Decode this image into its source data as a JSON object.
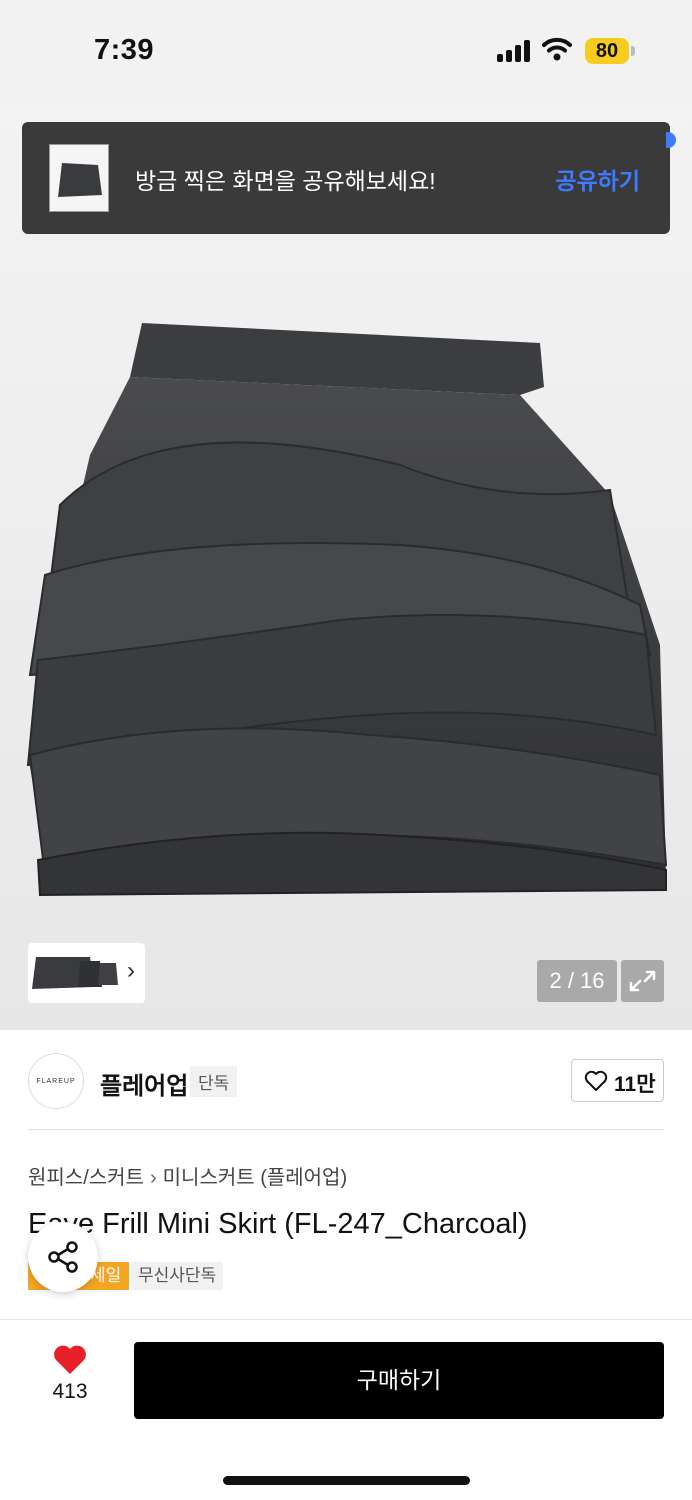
{
  "status_bar": {
    "time": "7:39",
    "battery": "80"
  },
  "toast": {
    "message": "방금 찍은 화면을 공유해보세요!",
    "action": "공유하기"
  },
  "gallery": {
    "counter": "2 / 16"
  },
  "brand": {
    "logo_text": "FLAREUP",
    "name": "플레어업",
    "tag": "단독",
    "likes": "11만"
  },
  "breadcrumb": {
    "level1": "원피스/스커트",
    "separator": "›",
    "level2": "미니스커트 (플레어업)"
  },
  "product": {
    "title": "Eave Frill Mini Skirt (FL-247_Charcoal)",
    "badges": [
      {
        "label": "세일"
      },
      {
        "label": "무신사단독"
      }
    ]
  },
  "bottom_bar": {
    "wish_count": "413",
    "buy_label": "구매하기"
  },
  "colors": {
    "accent_blue": "#3d7bff",
    "sale_badge": "#f4a623",
    "buy_button": "#000000",
    "heart": "#e8202a",
    "battery": "#f6cd1f"
  }
}
